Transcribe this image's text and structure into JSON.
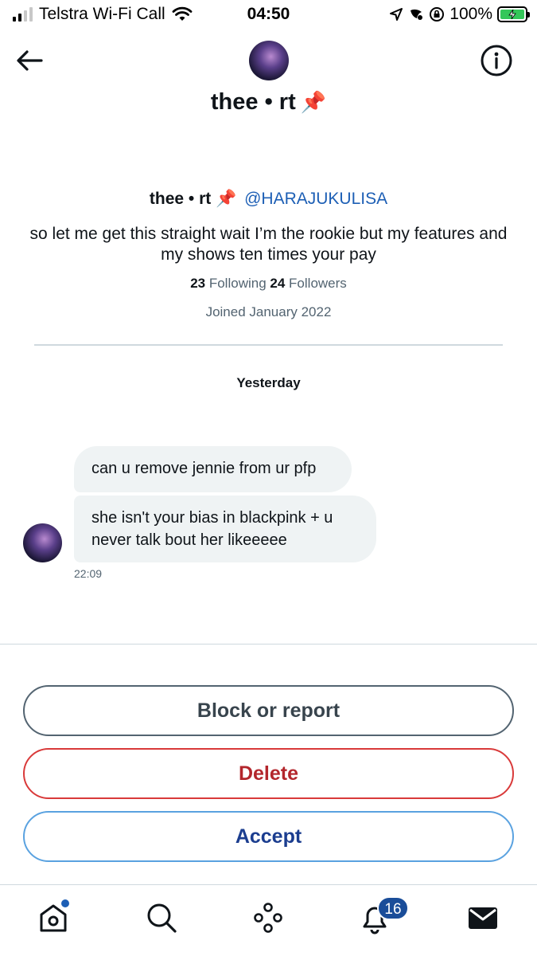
{
  "status_bar": {
    "carrier": "Telstra Wi-Fi Call",
    "time": "04:50",
    "battery": "100%"
  },
  "header": {
    "title": "thee • rt",
    "title_pin": "📌"
  },
  "profile": {
    "name": "thee • rt",
    "pin": "📌",
    "handle": "@HARAJUKULISA",
    "bio": "so let me get this straight wait I’m the rookie but my features and my shows ten times your pay",
    "following_count": "23",
    "following_label": "Following",
    "followers_count": "24",
    "followers_label": "Followers",
    "joined": "Joined January 2022"
  },
  "conversation": {
    "day_label": "Yesterday",
    "messages": [
      {
        "text": "can u remove jennie from ur pfp"
      },
      {
        "text": "she isn't your bias in blackpink + u never talk bout her likeeeee"
      }
    ],
    "time": "22:09"
  },
  "actions": {
    "block_label": "Block or report",
    "delete_label": "Delete",
    "accept_label": "Accept"
  },
  "tab_bar": {
    "notifications_badge": "16",
    "items": [
      "home-icon",
      "search-icon",
      "spaces-icon",
      "notifications-icon",
      "messages-icon"
    ]
  },
  "colors": {
    "accent": "#1d5fb5",
    "delete": "#b3262c",
    "bubble": "#eff3f4",
    "secondary_text": "#536471"
  }
}
